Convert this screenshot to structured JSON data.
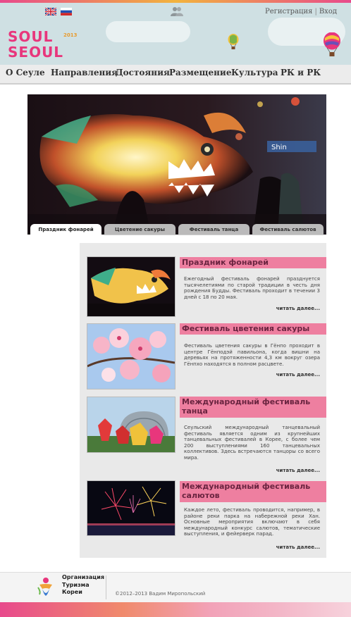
{
  "header": {
    "auth": {
      "register": "Регистрация",
      "separator": "|",
      "login": "Вход"
    },
    "logo": {
      "line1": "SOUL",
      "line2": "SEOUL",
      "year": "2013"
    }
  },
  "nav": {
    "items": [
      {
        "label": "О Сеуле"
      },
      {
        "label": "Направления"
      },
      {
        "label": "Достояния"
      },
      {
        "label": "Размещение"
      },
      {
        "label": "Культура"
      },
      {
        "label": "РК и РК"
      }
    ]
  },
  "hero": {
    "sign_text": "Shin",
    "tabs": [
      {
        "label": "Праздник фонарей",
        "active": true
      },
      {
        "label": "Цветение сакуры",
        "active": false
      },
      {
        "label": "Фестиваль танца",
        "active": false
      },
      {
        "label": "Фестиваль салютов",
        "active": false
      }
    ]
  },
  "cards": [
    {
      "title": "Праздник фонарей",
      "text": "Ежегодный фестиваль фонарей празднуется тысячелетиями по старой традиции в честь дня рождения Будды. Фестиваль проходит в течении 3 дней с 18 по 20 мая.",
      "more": "читать далее..."
    },
    {
      "title": "Фестиваль цветения сакуры",
      "text": "Фестиваль цветения сакуры в Гёнпо проходит в центре Гёнподэй павильона, когда вишни на деревьях на протяженности 4,3 км вокруг озера Гёнпхо находятся в полном расцвете.",
      "more": "читать далее..."
    },
    {
      "title": "Международный фестиваль танца",
      "text": "Сеульский международный танцевальный фестиваль является одним из крупнейших танцевальных фестивалей в Корее, с более чем 200 выступлениями 160 танцевальных коллективов. Здесь встречаются танцоры со всего мира.",
      "more": "читать далее..."
    },
    {
      "title": "Международный фестиваль салютов",
      "text": "Каждое лето, фестиваль проводится, например, в районе реки парка на набережной реки Хан. Основные мероприятия включают в себя международный конкурс салютов, тематические выступления, и фейерверк парад.",
      "more": "читать далее..."
    }
  ],
  "footer": {
    "org": {
      "line1": "Организация",
      "line2": "Туризма",
      "line3": "Кореи"
    },
    "copyright": "©2012–2013 Вадим Миропольский"
  },
  "colors": {
    "accent": "#ee7fa0",
    "brand": "#e8367c",
    "nav_bg": "#ececec",
    "header_bg": "#cfe0e3"
  }
}
